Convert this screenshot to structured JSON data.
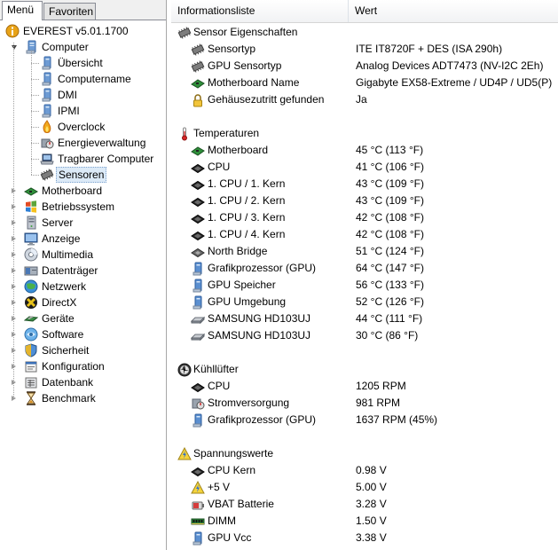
{
  "tabs": {
    "menu": "Menü",
    "favorites": "Favoriten"
  },
  "tree": {
    "root": "EVEREST v5.01.1700",
    "computer": "Computer",
    "computer_children": [
      "Übersicht",
      "Computername",
      "DMI",
      "IPMI",
      "Overclock",
      "Energieverwaltung",
      "Tragbarer Computer",
      "Sensoren"
    ],
    "categories": [
      "Motherboard",
      "Betriebssystem",
      "Server",
      "Anzeige",
      "Multimedia",
      "Datenträger",
      "Netzwerk",
      "DirectX",
      "Geräte",
      "Software",
      "Sicherheit",
      "Konfiguration",
      "Datenbank",
      "Benchmark"
    ]
  },
  "list": {
    "col1": "Informationsliste",
    "col2": "Wert",
    "groups": [
      {
        "title": "Sensor Eigenschaften",
        "icon": "sensor-chip-icon",
        "rows": [
          {
            "label": "Sensortyp",
            "value": "ITE IT8720F + DES  (ISA 290h)",
            "icon": "sensor-chip-icon"
          },
          {
            "label": "GPU Sensortyp",
            "value": "Analog Devices ADT7473  (NV-I2C 2Eh)",
            "icon": "sensor-chip-icon"
          },
          {
            "label": "Motherboard Name",
            "value": "Gigabyte EX58-Extreme / UD4P / UD5(P)",
            "icon": "motherboard-icon"
          },
          {
            "label": "Gehäusezutritt gefunden",
            "value": "Ja",
            "icon": "lock-icon"
          }
        ]
      },
      {
        "title": "Temperaturen",
        "icon": "thermometer-icon",
        "rows": [
          {
            "label": "Motherboard",
            "value": "45 °C  (113 °F)",
            "icon": "motherboard-icon"
          },
          {
            "label": "CPU",
            "value": "41 °C  (106 °F)",
            "icon": "cpu-icon"
          },
          {
            "label": "1. CPU / 1. Kern",
            "value": "43 °C  (109 °F)",
            "icon": "cpu-icon"
          },
          {
            "label": "1. CPU / 2. Kern",
            "value": "43 °C  (109 °F)",
            "icon": "cpu-icon"
          },
          {
            "label": "1. CPU / 3. Kern",
            "value": "42 °C  (108 °F)",
            "icon": "cpu-icon"
          },
          {
            "label": "1. CPU / 4. Kern",
            "value": "42 °C  (108 °F)",
            "icon": "cpu-icon"
          },
          {
            "label": "North Bridge",
            "value": "51 °C  (124 °F)",
            "icon": "chip-icon"
          },
          {
            "label": "Grafikprozessor (GPU)",
            "value": "64 °C  (147 °F)",
            "icon": "monitor-icon"
          },
          {
            "label": "GPU Speicher",
            "value": "56 °C  (133 °F)",
            "icon": "monitor-icon"
          },
          {
            "label": "GPU Umgebung",
            "value": "52 °C  (126 °F)",
            "icon": "monitor-icon"
          },
          {
            "label": "SAMSUNG HD103UJ",
            "value": "44 °C  (111 °F)",
            "icon": "hard-drive-icon"
          },
          {
            "label": "SAMSUNG HD103UJ",
            "value": "30 °C  (86 °F)",
            "icon": "hard-drive-icon"
          }
        ]
      },
      {
        "title": "Kühllüfter",
        "icon": "fan-icon",
        "rows": [
          {
            "label": "CPU",
            "value": "1205 RPM",
            "icon": "cpu-icon"
          },
          {
            "label": "Stromversorgung",
            "value": "981 RPM",
            "icon": "power-supply-icon"
          },
          {
            "label": "Grafikprozessor (GPU)",
            "value": "1637 RPM  (45%)",
            "icon": "monitor-icon"
          }
        ]
      },
      {
        "title": "Spannungswerte",
        "icon": "voltage-warning-icon",
        "rows": [
          {
            "label": "CPU Kern",
            "value": "0.98 V",
            "icon": "cpu-icon"
          },
          {
            "label": "+5 V",
            "value": "5.00 V",
            "icon": "voltage-warning-icon"
          },
          {
            "label": "VBAT Batterie",
            "value": "3.28 V",
            "icon": "battery-icon"
          },
          {
            "label": "DIMM",
            "value": "1.50 V",
            "icon": "memory-module-icon"
          },
          {
            "label": "GPU Vcc",
            "value": "3.38 V",
            "icon": "monitor-icon"
          }
        ]
      }
    ]
  }
}
